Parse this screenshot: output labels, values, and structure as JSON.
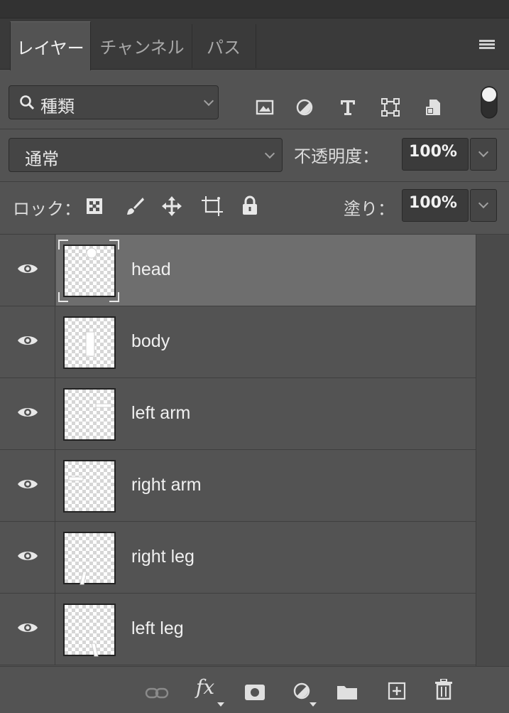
{
  "tabs": [
    {
      "label": "レイヤー",
      "active": true
    },
    {
      "label": "チャンネル",
      "active": false
    },
    {
      "label": "パス",
      "active": false
    }
  ],
  "filter": {
    "type_label": "種類",
    "icons": [
      "image-filter-icon",
      "adjustment-filter-icon",
      "type-filter-icon",
      "shape-filter-icon",
      "smart-object-filter-icon"
    ]
  },
  "blend": {
    "mode": "通常",
    "opacity_label": "不透明度：",
    "opacity_value": "100%"
  },
  "lock": {
    "label": "ロック：",
    "fill_label": "塗り：",
    "fill_value": "100%"
  },
  "layers": [
    {
      "name": "head",
      "selected": true
    },
    {
      "name": "body",
      "selected": false
    },
    {
      "name": "left arm",
      "selected": false
    },
    {
      "name": "right arm",
      "selected": false
    },
    {
      "name": "right leg",
      "selected": false
    },
    {
      "name": "left leg",
      "selected": false
    }
  ],
  "bottom": {
    "fx_label": "fx"
  },
  "colors": {
    "panel": "#535353",
    "selected_row": "#6e6e6e",
    "tabbar": "#3a3a3a"
  }
}
